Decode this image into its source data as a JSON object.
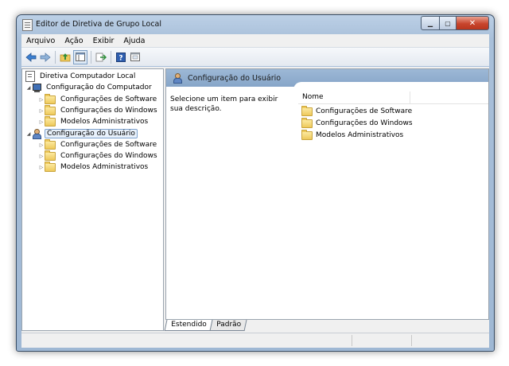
{
  "window": {
    "title": "Editor de Diretiva de Grupo Local",
    "close_glyph": "✕",
    "min_glyph": "▁",
    "max_glyph": "▢"
  },
  "menu": [
    "Arquivo",
    "Ação",
    "Exibir",
    "Ajuda"
  ],
  "toolbar": {
    "icons": [
      "back-arrow-icon",
      "forward-arrow-icon",
      "up-folder-icon",
      "show-hide-tree-icon",
      "export-list-icon",
      "help-icon",
      "properties-icon"
    ]
  },
  "tree": {
    "root": "Diretiva Computador Local",
    "computer": {
      "label": "Configuração do Computador",
      "children": [
        "Configurações de Software",
        "Configurações do Windows",
        "Modelos Administrativos"
      ]
    },
    "user": {
      "label": "Configuração do Usuário",
      "children": [
        "Configurações de Software",
        "Configurações do Windows",
        "Modelos Administrativos"
      ]
    },
    "expanded_glyph": "◢",
    "collapsed_glyph": "▷"
  },
  "details": {
    "header_title": "Configuração do Usuário",
    "description": "Selecione um item para exibir sua descrição.",
    "column_name": "Nome",
    "items": [
      "Configurações de Software",
      "Configurações do Windows",
      "Modelos Administrativos"
    ]
  },
  "tabs": [
    "Estendido",
    "Padrão"
  ],
  "colors": {
    "header_blue": "#9db8d6",
    "folder_yellow": "#eec95b",
    "close_red": "#c8452d"
  }
}
